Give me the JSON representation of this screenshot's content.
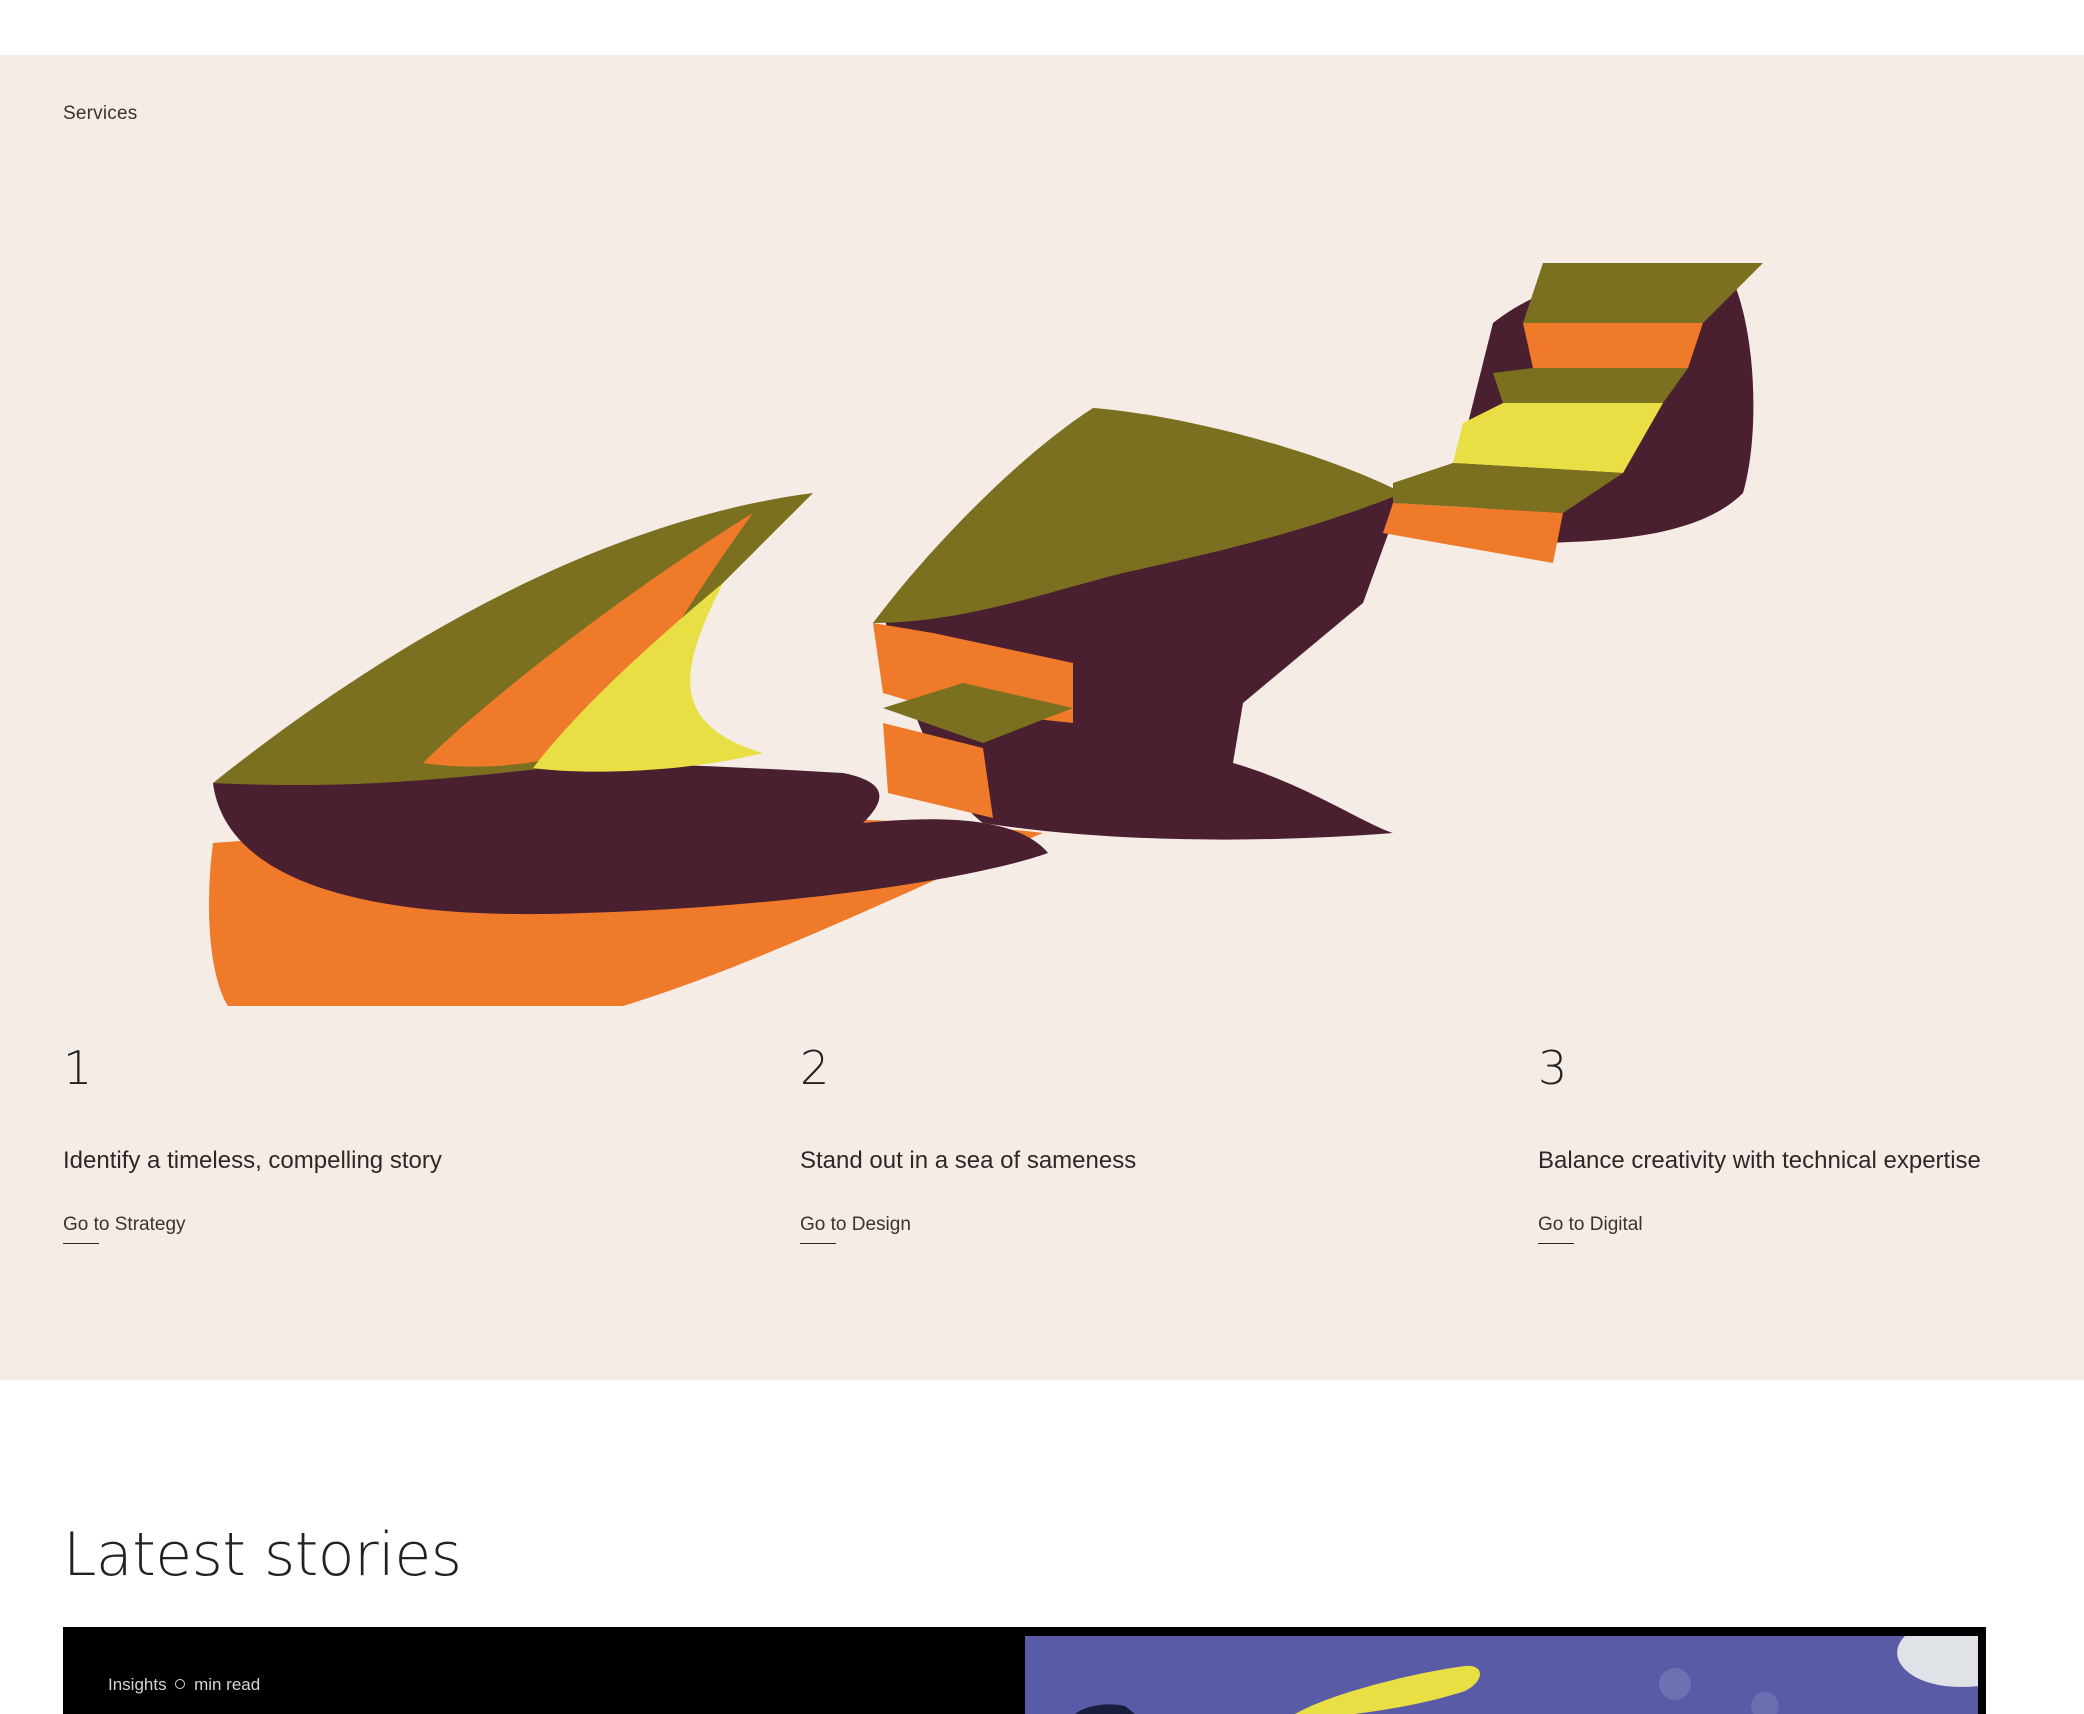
{
  "services": {
    "label": "Services",
    "items": [
      {
        "number": "1",
        "text": "Identify a timeless, compelling story",
        "link": "Go to Strategy"
      },
      {
        "number": "2",
        "text": "Stand out in a sea of sameness",
        "link": "Go to Design"
      },
      {
        "number": "3",
        "text": "Balance creativity with technical expertise",
        "link": "Go to Digital"
      }
    ]
  },
  "latest": {
    "heading": "Latest stories",
    "card": {
      "category": "Insights",
      "read_time": "min read"
    }
  },
  "colors": {
    "section_bg": "#f5ece6",
    "olive": "#7a7020",
    "orange": "#ee7a2a",
    "yellow": "#e8df45",
    "plum": "#4a1f30",
    "card_bg": "#000000",
    "thumb_bg": "#5a5ba6"
  }
}
